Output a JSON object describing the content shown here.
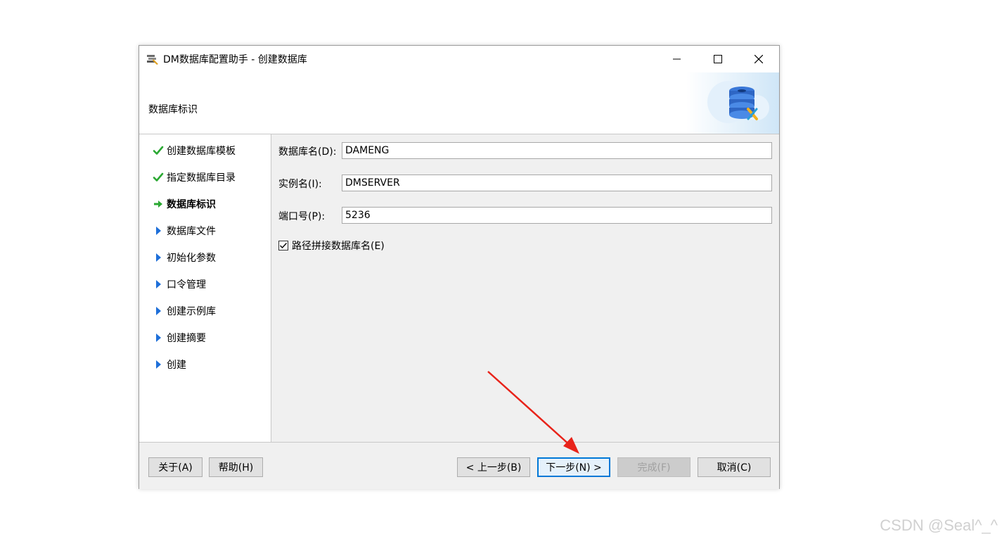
{
  "window": {
    "title": "DM数据库配置助手 - 创建数据库",
    "header_title": "数据库标识"
  },
  "steps": [
    {
      "label": "创建数据库模板",
      "state": "done"
    },
    {
      "label": "指定数据库目录",
      "state": "done"
    },
    {
      "label": "数据库标识",
      "state": "current"
    },
    {
      "label": "数据库文件",
      "state": "pending"
    },
    {
      "label": "初始化参数",
      "state": "pending"
    },
    {
      "label": "口令管理",
      "state": "pending"
    },
    {
      "label": "创建示例库",
      "state": "pending"
    },
    {
      "label": "创建摘要",
      "state": "pending"
    },
    {
      "label": "创建",
      "state": "pending"
    }
  ],
  "form": {
    "db_name_label": "数据库名(D):",
    "db_name_value": "DAMENG",
    "instance_label": "实例名(I):",
    "instance_value": "DMSERVER",
    "port_label": "端口号(P):",
    "port_value": "5236",
    "path_checkbox_label": "路径拼接数据库名(E)",
    "path_checkbox_checked": true
  },
  "footer": {
    "about": "关于(A)",
    "help": "帮助(H)",
    "prev": "< 上一步(B)",
    "next": "下一步(N) >",
    "finish": "完成(F)",
    "cancel": "取消(C)"
  },
  "watermark": "CSDN @Seal^_^",
  "colors": {
    "check": "#2aa832",
    "arrow_current": "#2aa832",
    "pending": "#1e6fd9",
    "annotation_arrow": "#e8231a",
    "primary_border": "#0078d7"
  }
}
